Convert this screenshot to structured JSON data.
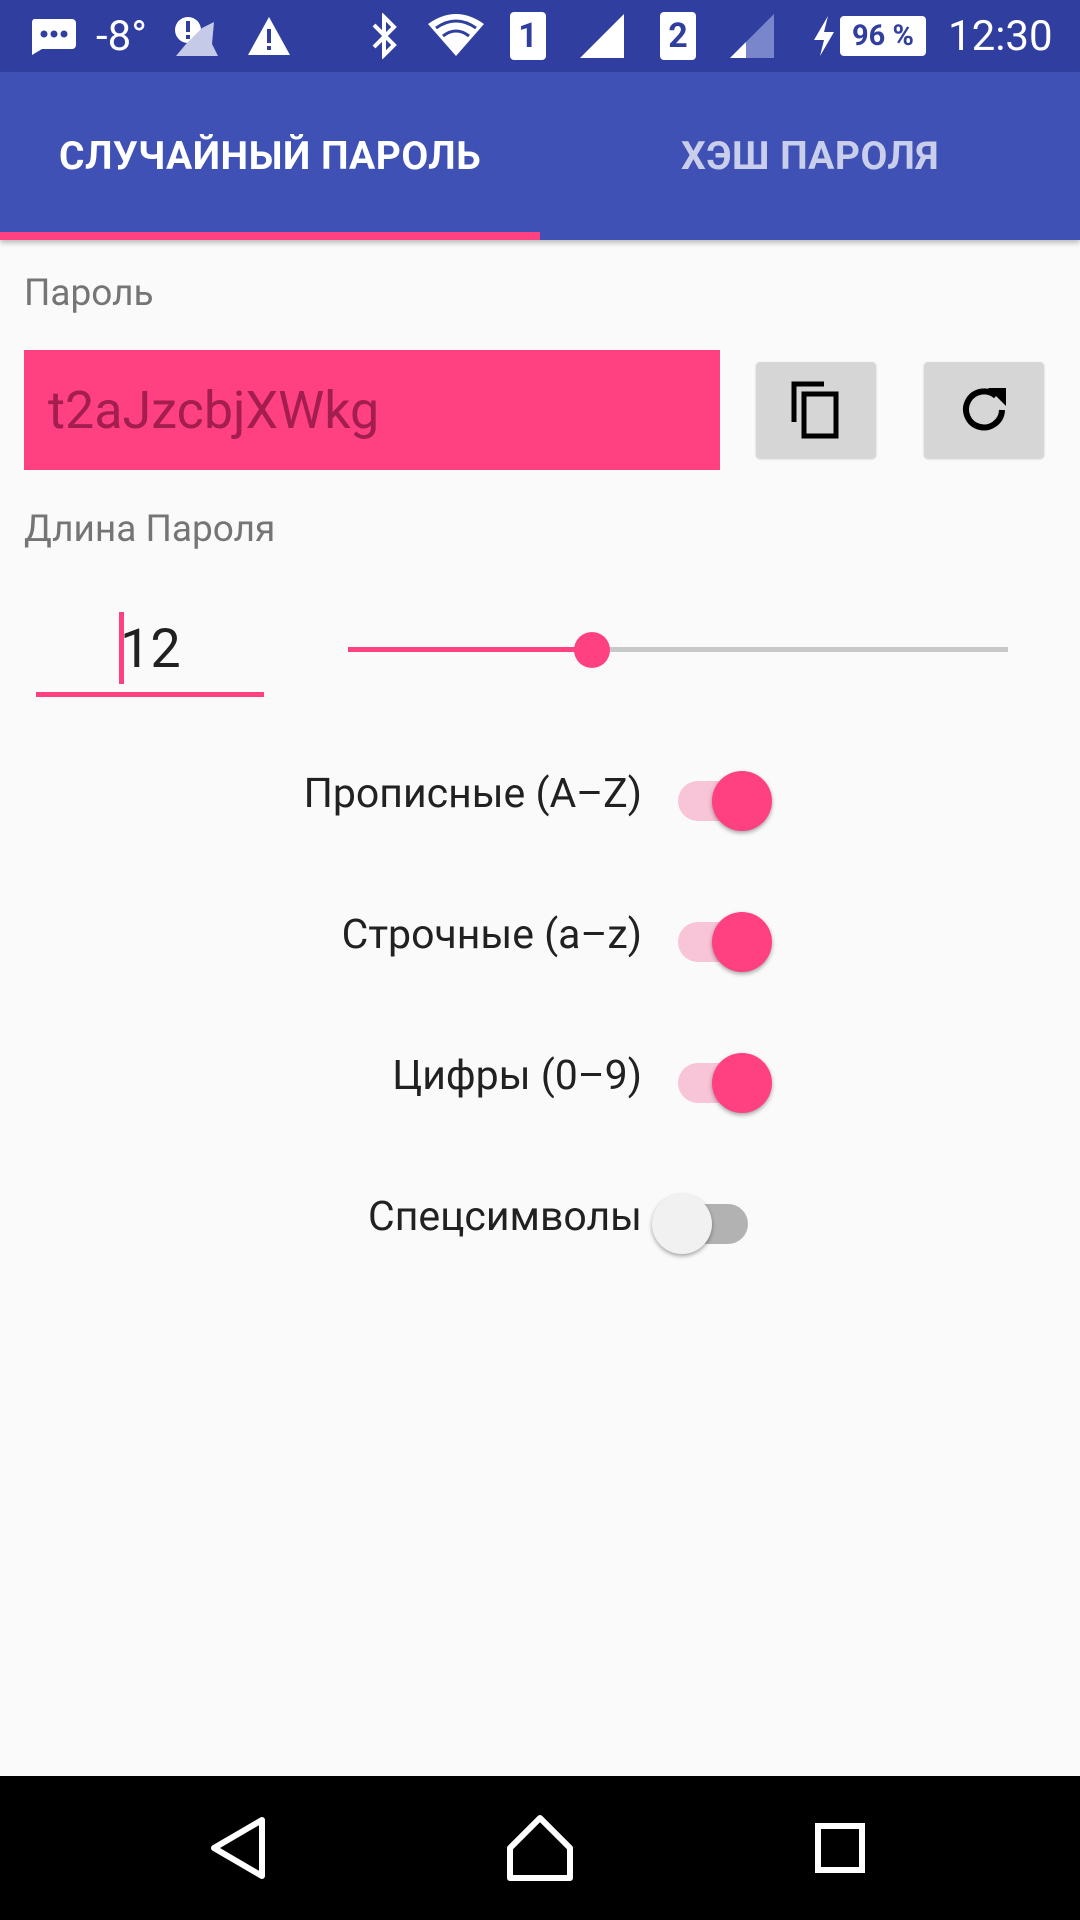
{
  "status_bar": {
    "temperature": "-8°",
    "sim1": "1",
    "sim2": "2",
    "battery": "96 %",
    "time": "12:30"
  },
  "tabs": [
    {
      "label": "СЛУЧАЙНЫЙ ПАРОЛЬ",
      "active": true
    },
    {
      "label": "ХЭШ ПАРОЛЯ",
      "active": false
    }
  ],
  "password": {
    "label": "Пароль",
    "value": "t2aJzcbjXWkg",
    "copy_icon": "copy-icon",
    "refresh_icon": "refresh-icon"
  },
  "length": {
    "label": "Длина Пароля",
    "value": "12",
    "slider_fraction": 0.37
  },
  "options": [
    {
      "label": "Прописные (A–Z)",
      "checked": true
    },
    {
      "label": "Строчные (a–z)",
      "checked": true
    },
    {
      "label": "Цифры (0–9)",
      "checked": true
    },
    {
      "label": "Спецсимволы",
      "checked": false
    }
  ],
  "colors": {
    "primary": "#3f51b5",
    "primary_dark": "#303f9f",
    "accent": "#ff4081"
  },
  "nav_bar": {
    "back_icon": "back-icon",
    "home_icon": "home-icon",
    "recents_icon": "recents-icon"
  }
}
